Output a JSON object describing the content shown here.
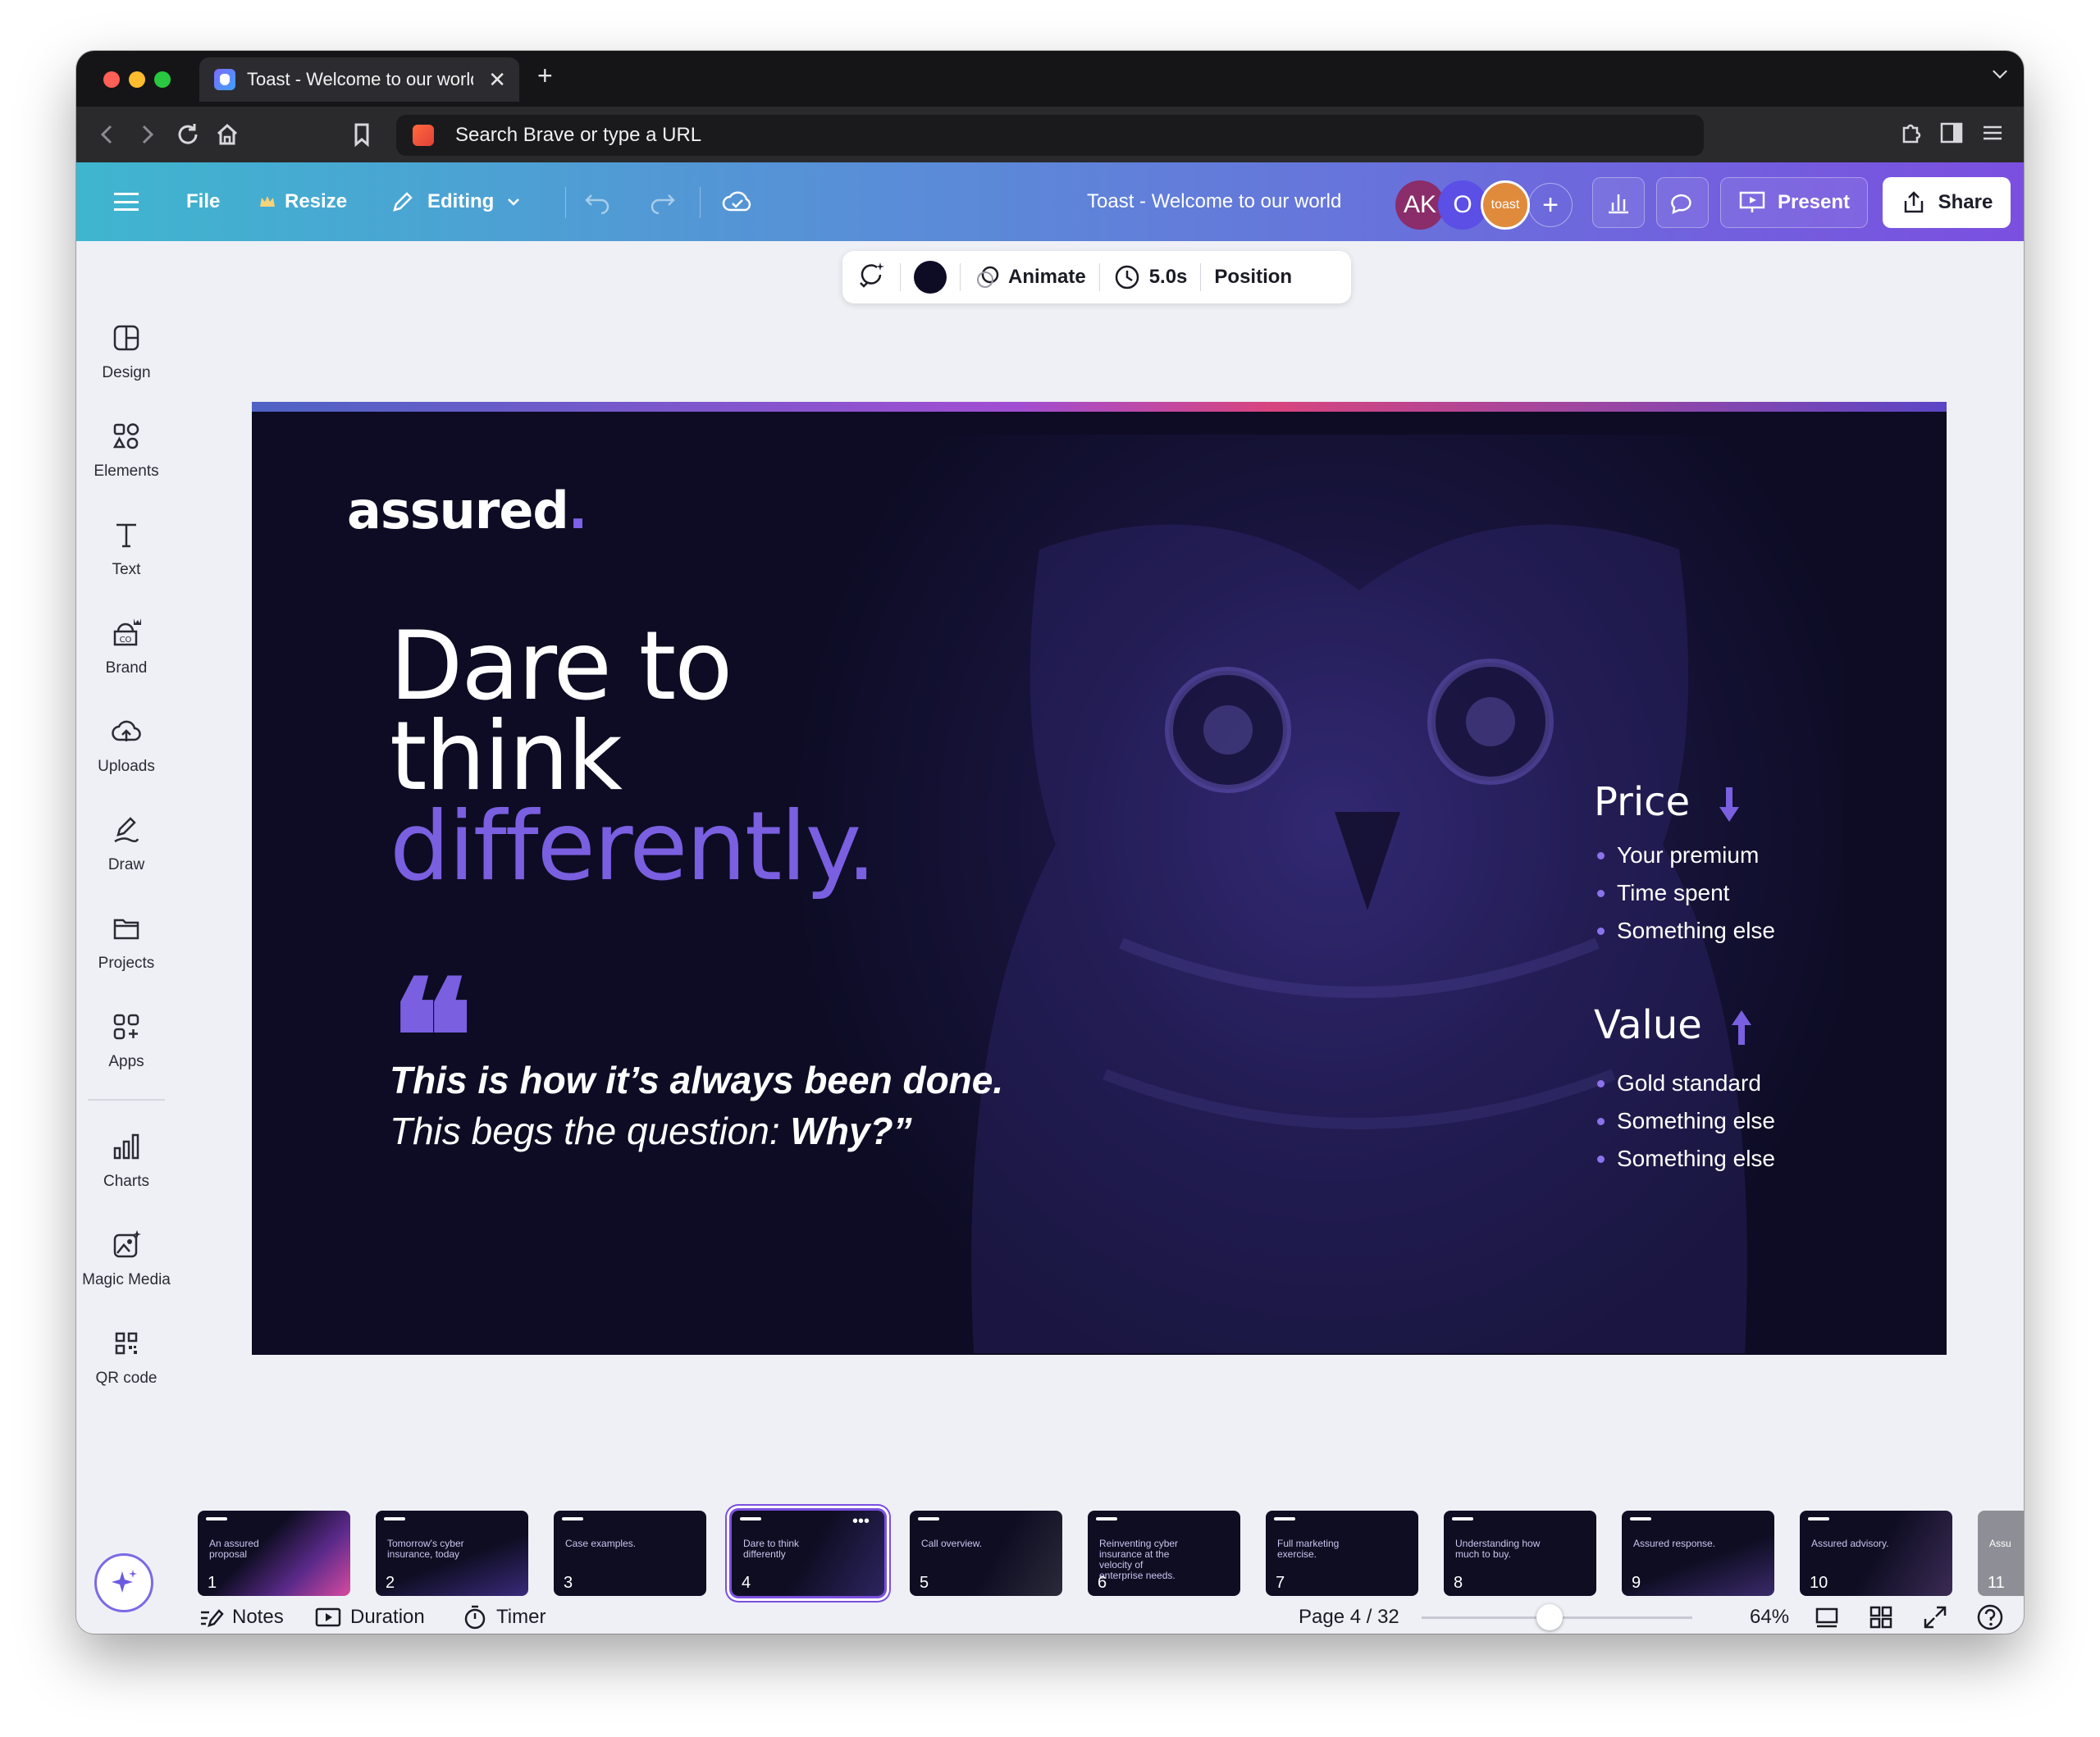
{
  "browser": {
    "tab_title": "Toast - Welcome to our world",
    "tab_close": "✕",
    "new_tab": "+",
    "address_placeholder": "Search Brave or type a URL"
  },
  "header": {
    "file": "File",
    "resize": "Resize",
    "editing": "Editing",
    "doc_title": "Toast - Welcome to our world",
    "avatars": [
      {
        "label": "AK",
        "color": "#8a2d6a"
      },
      {
        "label": "O",
        "color": "#5b4fe6"
      },
      {
        "label": "toast",
        "color": "#e08a3c"
      }
    ],
    "add": "+",
    "present": "Present",
    "share": "Share"
  },
  "rail": {
    "items": [
      {
        "label": "Design",
        "icon": "layout-icon"
      },
      {
        "label": "Elements",
        "icon": "shapes-icon"
      },
      {
        "label": "Text",
        "icon": "text-icon"
      },
      {
        "label": "Brand",
        "icon": "brand-icon"
      },
      {
        "label": "Uploads",
        "icon": "cloud-upload-icon"
      },
      {
        "label": "Draw",
        "icon": "pen-icon"
      },
      {
        "label": "Projects",
        "icon": "folder-icon"
      },
      {
        "label": "Apps",
        "icon": "apps-icon"
      },
      {
        "label": "Charts",
        "icon": "chart-icon"
      },
      {
        "label": "Magic Media",
        "icon": "magic-media-icon"
      },
      {
        "label": "QR code",
        "icon": "qr-icon"
      }
    ]
  },
  "floating_toolbar": {
    "animate": "Animate",
    "duration": "5.0s",
    "position": "Position",
    "color": "#0d0c24"
  },
  "slide": {
    "logo": "assured",
    "logo_dot": ".",
    "headline_1": "Dare to",
    "headline_2": "think",
    "headline_3": "differently.",
    "quote_mark": "❝",
    "quote_bold": "This is how it’s always been done.",
    "quote_regular": "This begs the question: ",
    "quote_why": "Why?”",
    "price_title": "Price",
    "price_items": [
      "Your premium",
      "Time spent",
      "Something else"
    ],
    "value_title": "Value",
    "value_items": [
      "Gold standard",
      "Something else",
      "Something else"
    ],
    "accent_color": "#7a5fe0"
  },
  "filmstrip": [
    {
      "num": "1",
      "label": "An assured proposal"
    },
    {
      "num": "2",
      "label": "Tomorrow's cyber insurance, today"
    },
    {
      "num": "3",
      "label": "Case examples."
    },
    {
      "num": "4",
      "label": "Dare to think differently"
    },
    {
      "num": "5",
      "label": "Call overview."
    },
    {
      "num": "6",
      "label": "Reinventing cyber insurance at the velocity of enterprise needs."
    },
    {
      "num": "7",
      "label": "Full marketing exercise."
    },
    {
      "num": "8",
      "label": "Understanding how much to buy."
    },
    {
      "num": "9",
      "label": "Assured response."
    },
    {
      "num": "10",
      "label": "Assured advisory."
    },
    {
      "num": "11",
      "label": "Assu"
    }
  ],
  "bottombar": {
    "notes": "Notes",
    "duration": "Duration",
    "timer": "Timer",
    "page": "Page 4 / 32",
    "zoom": "64%",
    "zoom_level": 0.64
  }
}
